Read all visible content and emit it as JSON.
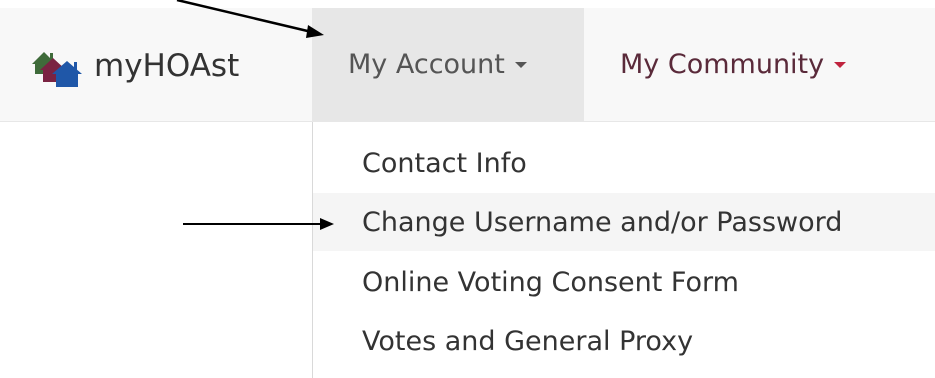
{
  "brand": {
    "name": "myHOAst",
    "logo_icon": "houses-logo-icon"
  },
  "nav": {
    "items": [
      {
        "label": "My Account",
        "state": "open"
      },
      {
        "label": "My Community",
        "state": "closed"
      }
    ]
  },
  "dropdown": {
    "items": [
      {
        "label": "Contact Info"
      },
      {
        "label": "Change Username and/or Password",
        "highlighted": true
      },
      {
        "label": "Online Voting Consent Form"
      },
      {
        "label": "Votes and General Proxy"
      }
    ]
  },
  "colors": {
    "navbar_bg": "#f8f8f8",
    "active_nav_bg": "#e7e7e7",
    "brand_text": "#333333",
    "community_caret": "#c0243e",
    "item_text": "#333333",
    "highlight_bg": "#f5f5f5",
    "logo_green": "#3f6b3a",
    "logo_maroon": "#7a2342",
    "logo_blue": "#1f57a8"
  }
}
